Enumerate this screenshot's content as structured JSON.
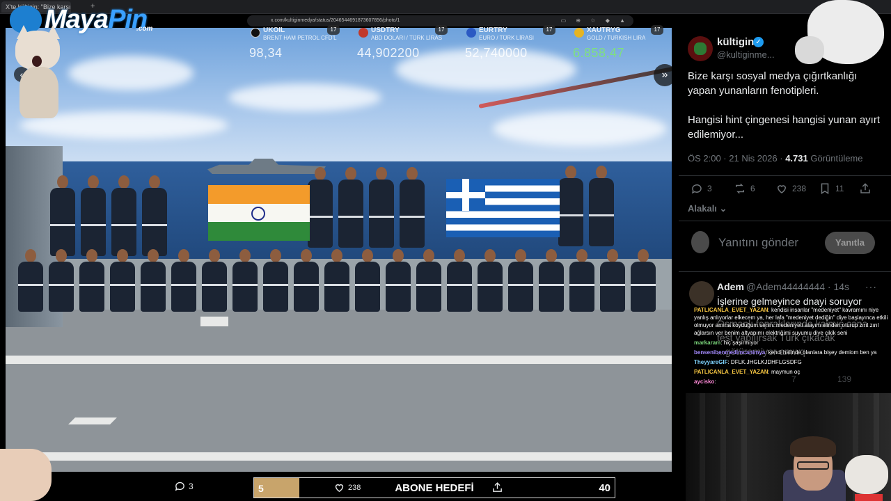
{
  "browser": {
    "tab_title": "X'te kültigin: \"Bize karşı sosyal",
    "url": "x.com/kultiginmedya/status/2046544691873607856/photo/1"
  },
  "overlay_logo": {
    "brand_main": "Maya",
    "brand_accent": "Pin",
    "suffix": ".com"
  },
  "ticker": [
    {
      "code": "UKOIL",
      "name": "BRENT HAM PETROL CFD'L",
      "value": "98,34",
      "badge": "17",
      "icon_color": "#111111"
    },
    {
      "code": "USDTRY",
      "name": "ABD DOLARI / TÜRK LİRAS",
      "value": "44,902200",
      "badge": "17",
      "icon_color": "#c0392b"
    },
    {
      "code": "EURTRY",
      "name": "EURO / TÜRK LİRASI",
      "value": "52,740000",
      "badge": "17",
      "icon_color": "#2b59c3"
    },
    {
      "code": "XAUTRYG",
      "name": "GOLD / TURKISH LIRA",
      "value": "6.858,47",
      "badge": "17",
      "icon_color": "#e6b422"
    }
  ],
  "tweet": {
    "author_name": "kültigin",
    "author_handle": "@kultiginme...",
    "text_p1": "Bize karşı sosyal medya çığırtkanlığı yapan yunanların fenotipleri.",
    "text_p2": "Hangisi hint çingenesi hangisi yunan ayırt edilemiyor...",
    "time": "ÖS 2:00 · 21 Nis 2026 · ",
    "views_count": "4.731",
    "views_label": " Görüntüleme",
    "replies": "3",
    "retweets": "6",
    "likes": "238",
    "bookmarks": "11",
    "sort_label": "Alakalı"
  },
  "reply_box": {
    "placeholder": "Yanıtını gönder",
    "button": "Yanıtla"
  },
  "reply": {
    "name": "Adem",
    "handle": "@Adem44444444 · 14s",
    "text": "İşlerine gelmeyince dnayi soruyor",
    "faded_text": "Osmanlı topraklarında kalmış cana... test yapılırsak Türk çıkacak ...götüremiyor amwq",
    "likes": "7",
    "views": "139"
  },
  "chat": [
    {
      "user": "PATLICANLA_EVET_YAZAN",
      "message": ": kendisi insanlar \"medeniyet\" kavramını niye yanlış anlıyorlar elkecem ya, her lafa \"medeniyet dediğin\" diye başlayınca etkili olmuyor amına koyduğum senin. medeniyeti alayım elinden oturup zırıl zırıl ağlarsın ver benim altyapımı elektriğimi suyumu diye çikik seni",
      "color": "#f5c542"
    },
    {
      "user": "markaram",
      "message": ": hiç şaşırmıyor",
      "color": "#7bd67b"
    },
    {
      "user": "bensenibenmedimcanimya",
      "message": ": kendi halinde olanlara bişey demiom ben ya",
      "color": "#a58bff"
    },
    {
      "user": "TheyyareGIF",
      "message": ": DFLK.JHGLKJDHFLGSDFG",
      "color": "#7fd3ff"
    },
    {
      "user": "PATLICANLA_EVET_YAZAN",
      "message": ": maymun oç",
      "color": "#f5c542"
    },
    {
      "user": "aycisko",
      "message": ":",
      "color": "#ff8ad8"
    }
  ],
  "bottom_bar": {
    "replies": "3",
    "likes": "238",
    "goal_current": "5",
    "goal_label": "ABONE HEDEFİ",
    "goal_target": "40",
    "goal_progress": 0.125
  }
}
